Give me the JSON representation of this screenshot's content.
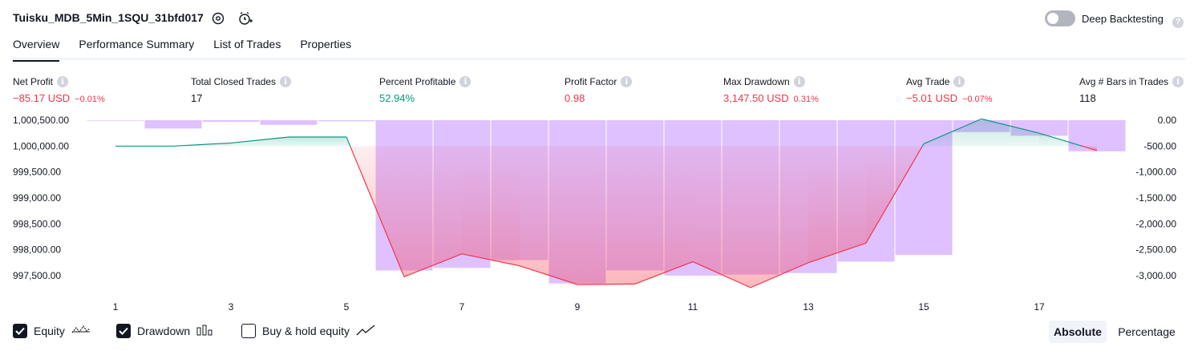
{
  "header": {
    "strategy_name": "Tuisku_MDB_5Min_1SQU_31bfd017",
    "deep_backtesting_label": "Deep Backtesting",
    "deep_backtesting_enabled": false
  },
  "tabs": [
    {
      "label": "Overview",
      "active": true
    },
    {
      "label": "Performance Summary",
      "active": false
    },
    {
      "label": "List of Trades",
      "active": false
    },
    {
      "label": "Properties",
      "active": false
    }
  ],
  "metrics": [
    {
      "label": "Net Profit",
      "value": "−85.17 USD",
      "sub": "−0.01%",
      "color": "#f23645"
    },
    {
      "label": "Total Closed Trades",
      "value": "17",
      "sub": "",
      "color": "#131722"
    },
    {
      "label": "Percent Profitable",
      "value": "52.94%",
      "sub": "",
      "color": "#089981"
    },
    {
      "label": "Profit Factor",
      "value": "0.98",
      "sub": "",
      "color": "#f23645"
    },
    {
      "label": "Max Drawdown",
      "value": "3,147.50 USD",
      "sub": "0.31%",
      "color": "#f23645"
    },
    {
      "label": "Avg Trade",
      "value": "−5.01 USD",
      "sub": "−0.07%",
      "color": "#f23645"
    },
    {
      "label": "Avg # Bars in Trades",
      "value": "118",
      "sub": "",
      "color": "#131722"
    }
  ],
  "chart_data": {
    "type": "line",
    "x_ticks": [
      "1",
      "3",
      "5",
      "7",
      "9",
      "11",
      "13",
      "15",
      "17"
    ],
    "left_axis_ticks": [
      "1,000,500.00",
      "1,000,000.00",
      "999,500.00",
      "999,000.00",
      "998,500.00",
      "998,000.00",
      "997,500.00"
    ],
    "right_axis_ticks": [
      "0.00",
      "-500.00",
      "-1,000.00",
      "-1,500.00",
      "-2,000.00",
      "-2,500.00",
      "-3,000.00"
    ],
    "left_ylim": [
      997500,
      1000500
    ],
    "right_ylim": [
      -3000,
      0
    ],
    "initial_capital": 1000000,
    "series": [
      {
        "name": "Equity",
        "color_above": "#089981",
        "color_below": "#f23645",
        "x": [
          1,
          2,
          3,
          4,
          5,
          6,
          7,
          8,
          9,
          10,
          11,
          12,
          13,
          14,
          15,
          16,
          17,
          18
        ],
        "values": [
          1000000,
          1000000,
          1000060,
          1000175,
          1000175,
          997480,
          997920,
          997690,
          997330,
          997340,
          997770,
          997270,
          997750,
          998130,
          1000045,
          1000525,
          1000250,
          999915
        ]
      },
      {
        "name": "Drawdown",
        "color": "#d1a7ff",
        "x": [
          1,
          2,
          3,
          4,
          5,
          6,
          7,
          8,
          9,
          10,
          11,
          12,
          13,
          14,
          15,
          16,
          17,
          18
        ],
        "values": [
          -10,
          -160,
          -30,
          -90,
          -20,
          -2900,
          -2850,
          -2700,
          -3150,
          -2900,
          -3000,
          -2980,
          -2950,
          -2730,
          -2600,
          -230,
          -300,
          -600
        ]
      }
    ]
  },
  "legend": {
    "equity": {
      "label": "Equity",
      "checked": true
    },
    "drawdown": {
      "label": "Drawdown",
      "checked": true
    },
    "buy_hold": {
      "label": "Buy & hold equity",
      "checked": false
    }
  },
  "scale_toggle": {
    "absolute_label": "Absolute",
    "percentage_label": "Percentage",
    "selected": "Absolute"
  }
}
